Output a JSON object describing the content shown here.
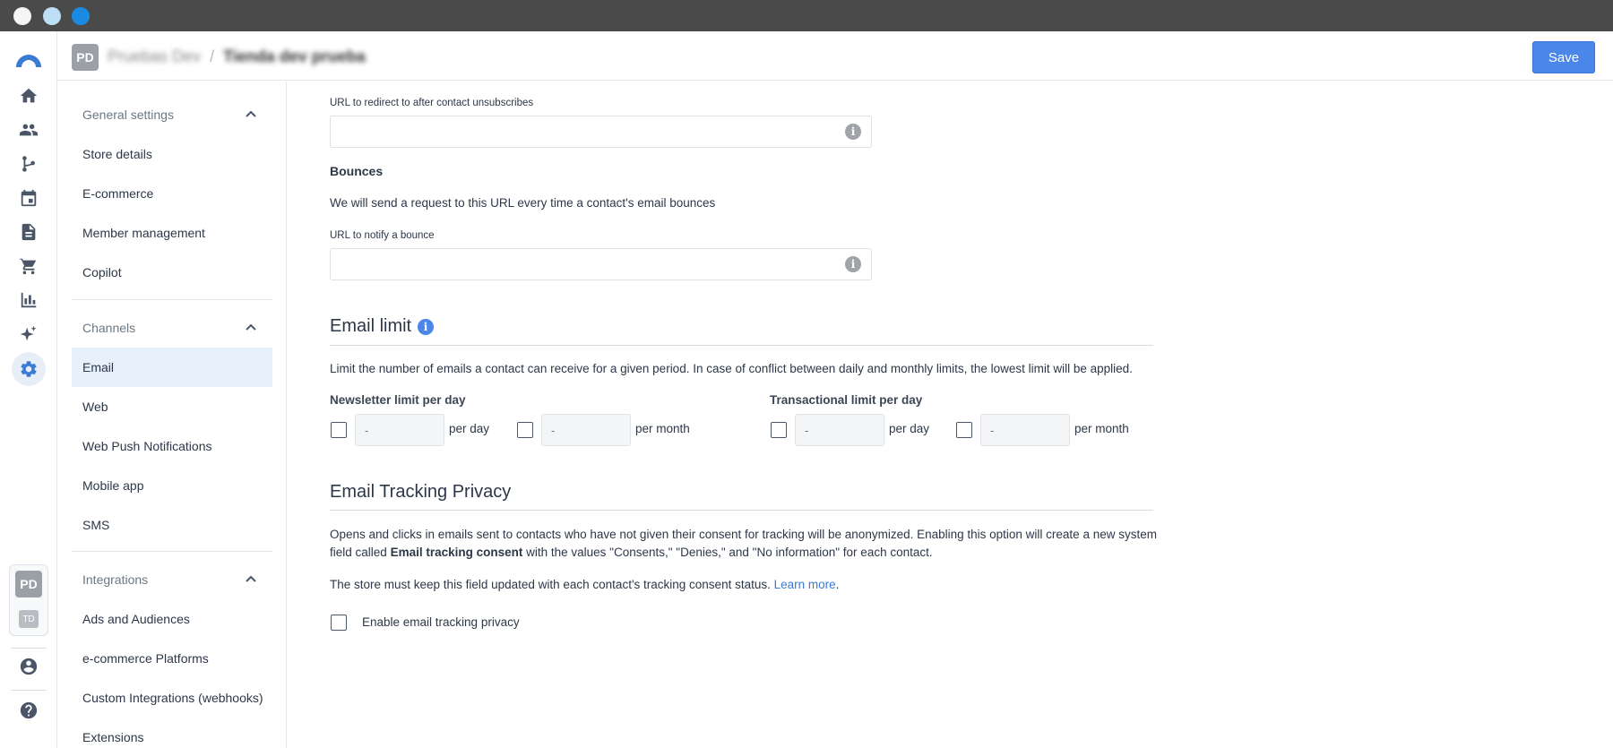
{
  "header": {
    "avatar": "PD",
    "org": "Pruebas Dev",
    "separator": "/",
    "store": "Tienda dev prueba",
    "save_label": "Save"
  },
  "rail": {
    "icons": [
      "logo-icon",
      "home-icon",
      "contacts-icon",
      "flow-icon",
      "calendar-icon",
      "document-icon",
      "cart-icon",
      "chart-icon",
      "sparkle-icon",
      "settings-icon",
      "user-circle-icon",
      "help-icon"
    ],
    "workspaces": [
      "PD",
      "TD"
    ]
  },
  "nav": {
    "general": {
      "label": "General settings",
      "items": [
        "Store details",
        "E-commerce",
        "Member management",
        "Copilot"
      ]
    },
    "channels": {
      "label": "Channels",
      "items": [
        "Email",
        "Web",
        "Web Push Notifications",
        "Mobile app",
        "SMS"
      ]
    },
    "integrations": {
      "label": "Integrations",
      "items": [
        "Ads and Audiences",
        "e-commerce Platforms",
        "Custom Integrations (webhooks)",
        "Extensions"
      ]
    }
  },
  "main": {
    "unsub_url_label": "URL to redirect to after contact unsubscribes",
    "bounces_title": "Bounces",
    "bounces_desc": "We will send a request to this URL every time a contact's email bounces",
    "bounce_url_label": "URL to notify a bounce",
    "email_limit": {
      "title": "Email limit",
      "desc": "Limit the number of emails a contact can receive for a given period. In case of conflict between daily and monthly limits, the lowest limit will be applied.",
      "newsletter_label": "Newsletter limit per day",
      "transactional_label": "Transactional limit per day",
      "placeholder": "-",
      "per_day": "per day",
      "per_month": "per month"
    },
    "tracking": {
      "title": "Email Tracking Privacy",
      "desc_1": "Opens and clicks in emails sent to contacts who have not given their consent for tracking will be anonymized. Enabling this option will create a new system field called",
      "desc_bold": "Email tracking consent",
      "desc_2": "with the values \"Consents,\" \"Denies,\" and \"No information\" for each contact.",
      "store_note": "The store must keep this field updated with each contact's tracking consent status.",
      "learn_more": "Learn more",
      "period": ".",
      "enable_label": "Enable email tracking privacy"
    }
  },
  "colors": {
    "accent": "#4a87e8",
    "active_nav_bg": "#e6f1fc",
    "link": "#3a7bd5"
  }
}
